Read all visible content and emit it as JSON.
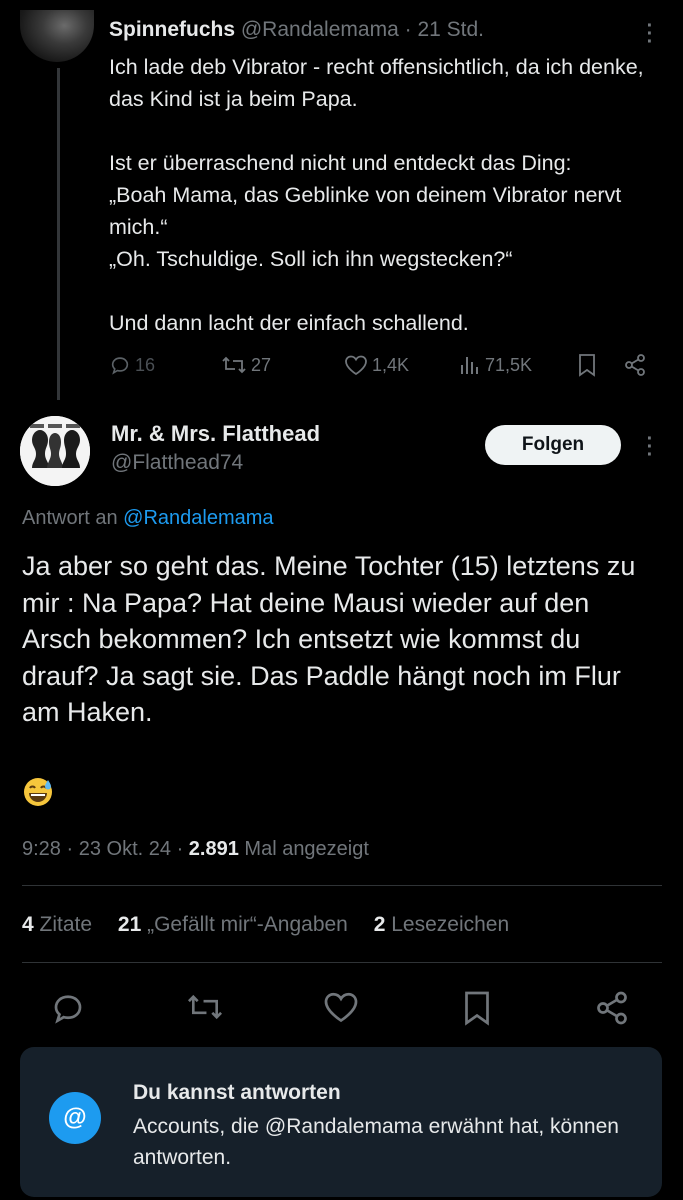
{
  "parent_tweet": {
    "name": "Spinnefuchs",
    "handle": "@Randalemama",
    "time": "21 Std.",
    "paragraphs": [
      "Ich lade deb Vibrator - recht offensichtlich, da ich denke, das Kind ist  ja beim Papa.",
      "Ist er überraschend nicht und entdeckt das Ding:\n„Boah Mama, das Geblinke von deinem  Vibrator nervt mich.“\n„Oh. Tschuldige. Soll ich ihn wegstecken?“",
      "Und dann lacht der einfach schallend."
    ],
    "actions": {
      "replies": "16",
      "reposts": "27",
      "likes": "1,4K",
      "views": "71,5K"
    }
  },
  "main_tweet": {
    "name": "Mr. & Mrs. Flatthead",
    "handle": "@Flatthead74",
    "follow_label": "Folgen",
    "reply_prefix": "Antwort an",
    "reply_handle": "@Randalemama",
    "text": "Ja aber so geht das. Meine Tochter (15) letztens zu mir : Na Papa? Hat deine Mausi wieder auf den Arsch bekommen? Ich entsetzt wie kommst du drauf? Ja sagt sie. Das Paddle hängt noch im Flur am Haken.",
    "time": "9:28",
    "date": "23 Okt. 24",
    "views_count": "2.891",
    "views_label": "Mal angezeigt",
    "quotes_count": "4",
    "quotes_label": "Zitate",
    "likes_count": "21",
    "likes_label": "„Gefällt mir“-Angaben",
    "bookmarks_count": "2",
    "bookmarks_label": "Lesezeichen"
  },
  "reply_card": {
    "title": "Du kannst antworten",
    "body": "Accounts, die @Randalemama erwähnt hat, können antworten."
  },
  "colors": {
    "background": "#000000",
    "text_primary": "#e7e9ea",
    "text_secondary": "#71767b",
    "accent": "#1d9bf0",
    "card_bg": "#16202a"
  }
}
